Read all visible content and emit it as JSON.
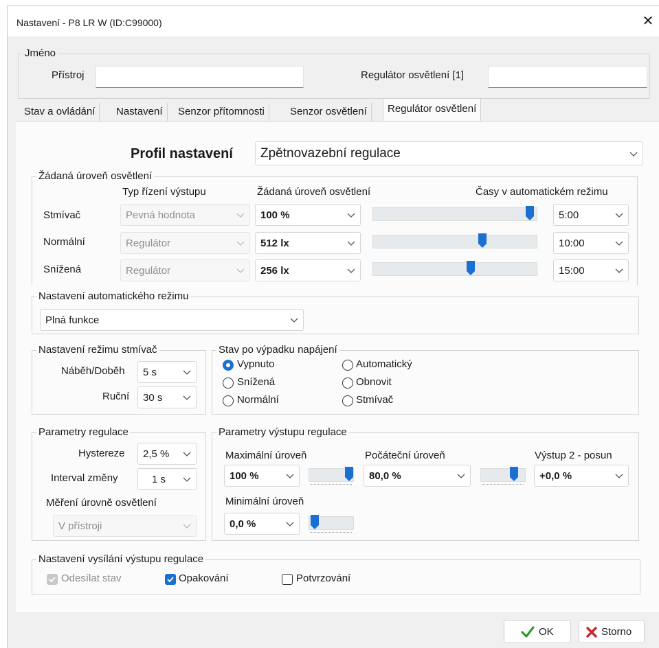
{
  "window": {
    "title": "Nastavení - P8 LR W (ID:C99000)",
    "close_symbol": "✕"
  },
  "name_group": {
    "legend": "Jméno",
    "device_label": "Přístroj",
    "device_value": "",
    "regulator_label": "Regulátor osvětlení [1]",
    "regulator_value": ""
  },
  "tabs": [
    {
      "label": "Stav a ovládání"
    },
    {
      "label": "Nastavení"
    },
    {
      "label": "Senzor přítomnosti"
    },
    {
      "label": "Senzor osvětlení"
    },
    {
      "label": "Regulátor osvětlení",
      "active": true
    }
  ],
  "profile": {
    "label": "Profil nastavení",
    "value": "Zpětnovazební regulace"
  },
  "levels_group": {
    "legend": "Žádaná úroveň osvětlení",
    "col_type": "Typ řízení výstupu",
    "col_level": "Žádaná úroveň osvětlení",
    "col_times": "Časy v automatickém režimu",
    "rows": [
      {
        "label": "Stmívač",
        "type": "Pevná hodnota",
        "level": "100 %",
        "slider": 0.98,
        "time": "5:00"
      },
      {
        "label": "Normální",
        "type": "Regulátor",
        "level": "512 lx",
        "slider": 0.675,
        "time": "10:00"
      },
      {
        "label": "Snížená",
        "type": "Regulátor",
        "level": "256 lx",
        "slider": 0.6,
        "time": "15:00"
      }
    ]
  },
  "auto_mode": {
    "legend": "Nastavení automatického režimu",
    "value": "Plná funkce"
  },
  "dimmer_mode": {
    "legend": "Nastavení režimu stmívač",
    "ramp_label": "Náběh/Doběh",
    "ramp_value": "5 s",
    "manual_label": "Ruční",
    "manual_value": "30 s"
  },
  "power_fail": {
    "legend": "Stav po výpadku napájení",
    "options": [
      {
        "label": "Vypnuto",
        "selected": true
      },
      {
        "label": "Snížená",
        "selected": false
      },
      {
        "label": "Normální",
        "selected": false
      },
      {
        "label": "Automatický",
        "selected": false
      },
      {
        "label": "Obnovit",
        "selected": false
      },
      {
        "label": "Stmívač",
        "selected": false
      }
    ]
  },
  "reg_params": {
    "legend": "Parametry regulace",
    "hyst_label": "Hystereze",
    "hyst_value": "2,5 %",
    "interval_label": "Interval změny",
    "interval_value": "1 s",
    "measure_label": "Měření úrovně osvětlení",
    "measure_value": "V přístroji"
  },
  "output_params": {
    "legend": "Parametry výstupu regulace",
    "max_label": "Maximální úroveň",
    "max_value": "100 %",
    "max_slider": 1.0,
    "init_label": "Počáteční úroveň",
    "init_value": "80,0 %",
    "init_slider": 0.8,
    "out2_label": "Výstup 2 - posun",
    "out2_value": "+0,0 %",
    "min_label": "Minimální úroveň",
    "min_value": "0,0 %",
    "min_slider": 0.0
  },
  "send": {
    "legend": "Nastavení vysílání výstupu regulace",
    "send_state": {
      "label": "Odesílat stav",
      "checked": true,
      "disabled": true
    },
    "repeat": {
      "label": "Opakování",
      "checked": true
    },
    "confirm": {
      "label": "Potvrzování",
      "checked": false
    }
  },
  "buttons": {
    "ok": "OK",
    "cancel": "Storno"
  },
  "colors": {
    "accent": "#1a6fd1",
    "ok_green": "#2e9b2e",
    "cancel_red": "#c4262e"
  }
}
